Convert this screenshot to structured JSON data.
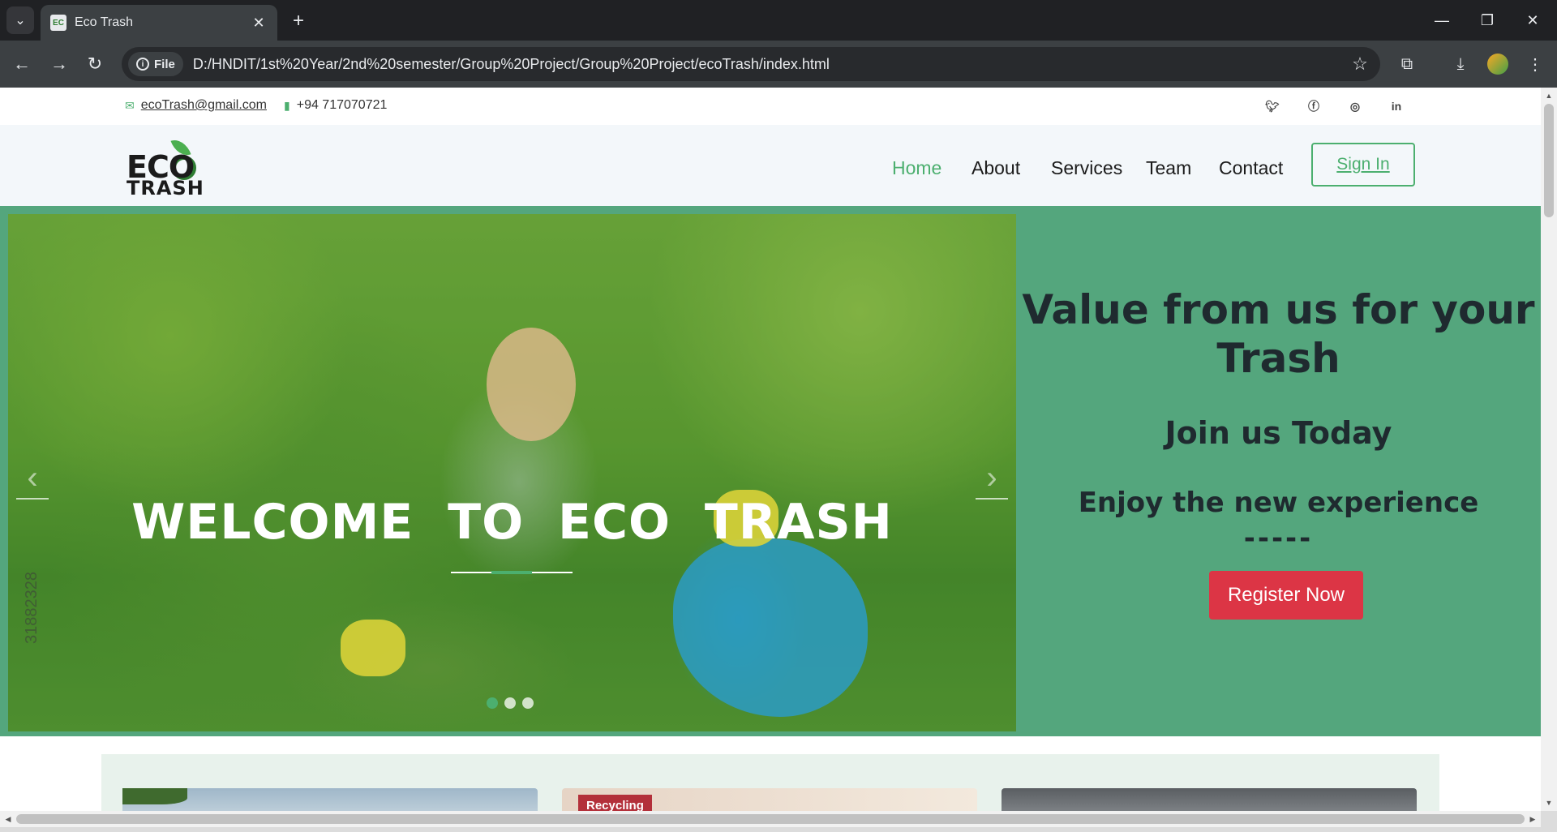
{
  "browser": {
    "tab_title": "Eco Trash",
    "favicon_text": "EC",
    "omnibox_chip": "File",
    "url": "D:/HNDIT/1st%20Year/2nd%20semester/Group%20Project/Group%20Project/ecoTrash/index.html"
  },
  "topbar": {
    "email": "ecoTrash@gmail.com",
    "phone": "+94 717070721",
    "social_icons": [
      "twitter-icon",
      "facebook-icon",
      "instagram-icon",
      "linkedin-icon"
    ]
  },
  "logo": {
    "line1": "ECO",
    "line2": "TRASH"
  },
  "nav": {
    "items": [
      {
        "label": "Home",
        "active": true
      },
      {
        "label": "About",
        "active": false
      },
      {
        "label": "Services",
        "active": false
      },
      {
        "label": "Team",
        "active": false
      },
      {
        "label": "Contact",
        "active": false
      }
    ],
    "signin_label": "Sign In"
  },
  "hero": {
    "slide_title": "WELCOME TO ECO TRASH",
    "watermark": "31882328",
    "slides_count": 3,
    "active_slide": 1,
    "heading": "Value from us for your Trash",
    "subheading": "Join us Today",
    "tagline": "Enjoy the new experience",
    "divider": "-----",
    "register_label": "Register Now"
  },
  "cards": {
    "card2_label": "Recycling"
  },
  "colors": {
    "accent_green": "#4caf6f",
    "hero_bg": "#54a67d",
    "register_red": "#dc3545",
    "heading_dark": "#1f2a2f"
  }
}
